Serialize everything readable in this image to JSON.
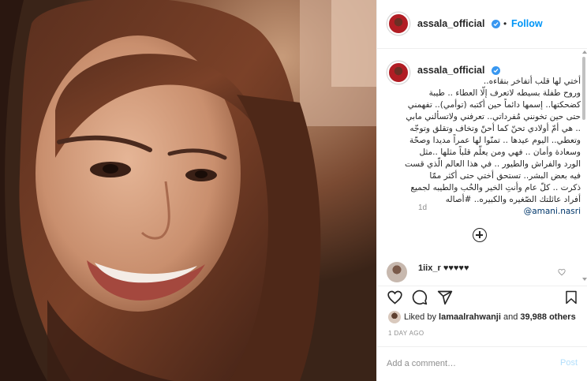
{
  "post": {
    "image_alt": "Photo of a smiling woman with long brown hair",
    "header": {
      "username": "assala_official",
      "separator": "•",
      "follow_label": "Follow"
    },
    "caption": {
      "username": "assala_official",
      "lines": [
        "أختي لها قلب أتفاخر بنقاءه..",
        "وروح طفلة بسيطه لاتعرف إلّا العطاء .. طيبة",
        "كضحكتها.. إسمها دائماً حين أكتبه (توأمي).. تفهمني",
        "حتى حين تخونني مُفرداتي.. تعرفني ولاتسألني مابي",
        ".. هي أمّ أولادي تحنّ كما أحنّ وتخاف وتقلق وتوجّه",
        "وتعطي.. اليوم عيدها .. تمنّوا لها عمراً مديدا وصحّة",
        "وسعادة وأمان .. فهي ومن يعلّم قلباً مثلها ..مثل",
        "الورد والفراش والطيور .. في هذا العالم الّذي قست",
        "فيه بعض البشر.. تستحق أختي حتى أكثر ممّا",
        "ذكرت .. كلّ عام وأنتِ الخير والحُب والطيبه لجميع",
        "أفراد عائلتك الصّغيره والكبيره.. #أصاله"
      ],
      "mention": "@amani.nasri",
      "age": "1d"
    },
    "load_more_label": "Load more comments",
    "comments": [
      {
        "username": "1iix_r",
        "text": "♥♥♥♥♥"
      }
    ],
    "likes": {
      "prefix": "Liked by ",
      "user": "lamaalrahwanji",
      "middle": " and ",
      "count": "39,988 others"
    },
    "timestamp": "1 DAY AGO",
    "comment_input": {
      "placeholder": "Add a comment…",
      "value": ""
    },
    "post_button": "Post"
  },
  "icons": {
    "verified": "verified-badge-icon",
    "like": "heart-icon",
    "comment": "comment-icon",
    "share": "share-icon",
    "save": "bookmark-icon",
    "load_more": "plus-circle-icon"
  },
  "colors": {
    "link_blue": "#0095f6",
    "verified_blue": "#3897f0",
    "post_disabled": "#b2dffc",
    "mention": "#00376b",
    "muted": "#8e8e8e",
    "text": "#262626"
  }
}
